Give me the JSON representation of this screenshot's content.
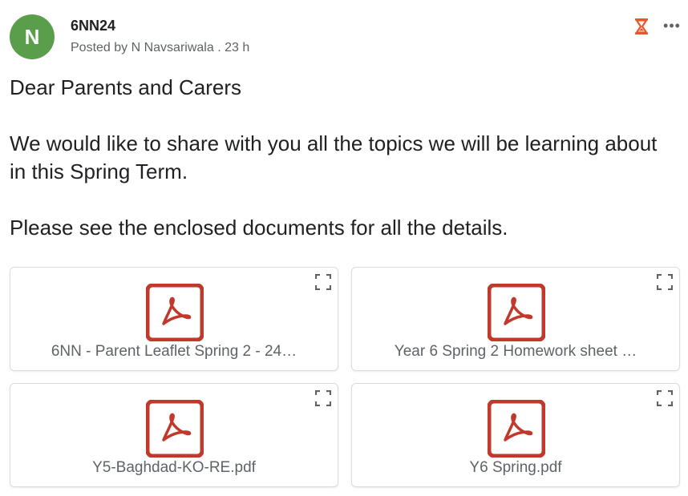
{
  "post": {
    "avatar_letter": "N",
    "avatar_color": "#5a9e4b",
    "title": "6NN24",
    "meta": "Posted by N Navsariwala . 23 h",
    "status_icon": "hourglass-icon",
    "status_color": "#e8572d",
    "more_label": "•••"
  },
  "body": {
    "greeting": "Dear Parents and Carers",
    "paragraph1": "We would like to share with you all the topics we will be learning about in this Spring Term.",
    "paragraph2": "Please see the enclosed documents for all the details."
  },
  "attachments": [
    {
      "file_name": "6NN - Parent Leaflet Spring 2 - 24…",
      "icon": "pdf-icon"
    },
    {
      "file_name": "Year 6 Spring 2 Homework sheet …",
      "icon": "pdf-icon"
    },
    {
      "file_name": "Y5-Baghdad-KO-RE.pdf",
      "icon": "pdf-icon"
    },
    {
      "file_name": "Y6 Spring.pdf",
      "icon": "pdf-icon"
    }
  ],
  "colors": {
    "pdf_red": "#c0392b",
    "muted_text": "#5f6368"
  }
}
